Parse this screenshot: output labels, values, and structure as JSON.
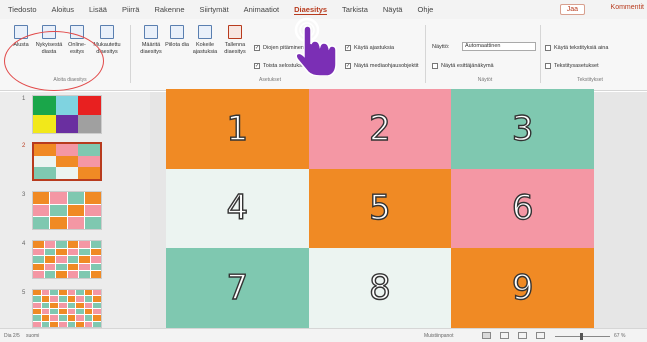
{
  "tabs": [
    {
      "label": "Tiedosto",
      "active": false
    },
    {
      "label": "Aloitus",
      "active": false
    },
    {
      "label": "Lisää",
      "active": false
    },
    {
      "label": "Piirrä",
      "active": false
    },
    {
      "label": "Rakenne",
      "active": false
    },
    {
      "label": "Siirtymät",
      "active": false
    },
    {
      "label": "Animaatiot",
      "active": false
    },
    {
      "label": "Diaesitys",
      "active": true
    },
    {
      "label": "Tarkista",
      "active": false
    },
    {
      "label": "Näytä",
      "active": false
    },
    {
      "label": "Ohje",
      "active": false
    }
  ],
  "header": {
    "share": "Jaa",
    "comments": "Kommentit"
  },
  "ribbon": {
    "start_group": {
      "label": "Aloita diaesitys",
      "buttons": [
        "Alusta",
        "Nykyisestä diasta",
        "Online-esitys",
        "Mukautettu diaesitys"
      ]
    },
    "setup_buttons": [
      "Määritä diaesitys",
      "Piilota dia",
      "Kokeile ajastuksia",
      "Tallenna diaesitys"
    ],
    "setup_checks": [
      "Diojen pitäminen",
      "Toista selostukset",
      "Käytä ajastuksia",
      "Näytä mediaohjausobjektit"
    ],
    "setup_group_label": "Asetukset",
    "monitor_label": "Näyttö:",
    "monitor_value": "Automaattinen",
    "presenter_view": "Näytä esittäjänäkymä",
    "monitors_group_label": "Näytöt",
    "captions_check": "Käytä tekstityksiä aina",
    "captions_settings": "Tekstitysasetukset",
    "captions_group_label": "Tekstitykset"
  },
  "thumbnails": [
    {
      "num": "1",
      "selected": false
    },
    {
      "num": "2",
      "selected": true
    },
    {
      "num": "3",
      "selected": false
    },
    {
      "num": "4",
      "selected": false
    },
    {
      "num": "5",
      "selected": false
    }
  ],
  "slide": {
    "cells": [
      {
        "number": "1",
        "color": "#f08a24"
      },
      {
        "number": "2",
        "color": "#f497a4"
      },
      {
        "number": "3",
        "color": "#7fc8b0"
      },
      {
        "number": "4",
        "color": "#ecf4f1"
      },
      {
        "number": "5",
        "color": "#f08a24"
      },
      {
        "number": "6",
        "color": "#f497a4"
      },
      {
        "number": "7",
        "color": "#7fc8b0"
      },
      {
        "number": "8",
        "color": "#ecf4f1"
      },
      {
        "number": "9",
        "color": "#f08a24"
      }
    ]
  },
  "status": {
    "slide_info": "Dia 2/5",
    "language": "suomi",
    "notes": "Muistiinpanot",
    "zoom": "67 %"
  },
  "colors": {
    "accent": "#b83b1e",
    "cursor": "#7b2fb5"
  }
}
